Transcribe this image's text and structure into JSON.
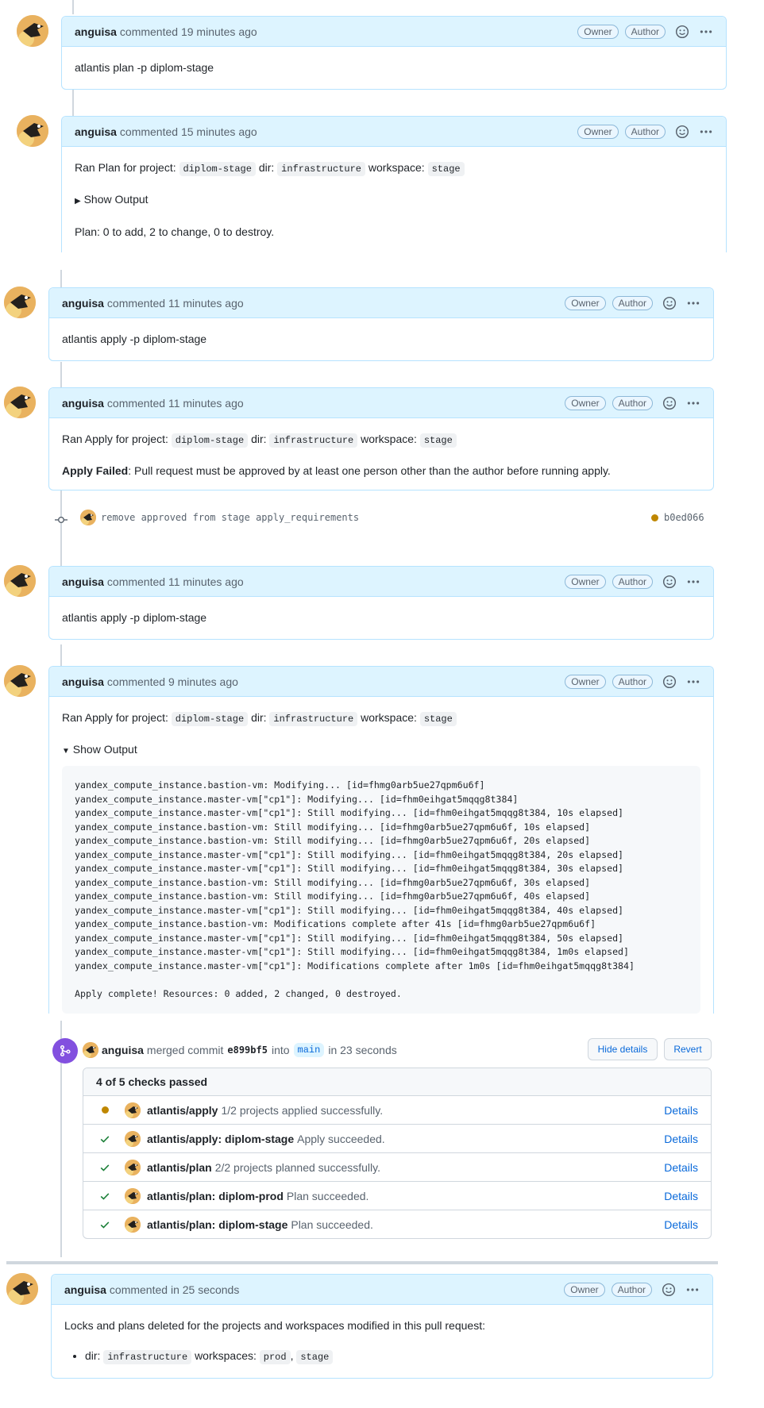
{
  "labels": {
    "owner": "Owner",
    "author": "Author",
    "commented": "commented",
    "show_output": "Show Output"
  },
  "comments": {
    "c1": {
      "author": "anguisa",
      "time": "19 minutes ago",
      "text": "atlantis plan -p diplom-stage"
    },
    "c2": {
      "author": "anguisa",
      "time": "15 minutes ago",
      "p1": "Ran Plan for project:",
      "project": "diplom-stage",
      "dir_label": "dir:",
      "dir": "infrastructure",
      "ws_label": "workspace:",
      "ws": "stage",
      "summary": "Show Output",
      "plan": "Plan: 0 to add, 2 to change, 0 to destroy."
    },
    "c3": {
      "author": "anguisa",
      "time": "11 minutes ago",
      "text": "atlantis apply -p diplom-stage"
    },
    "c4": {
      "author": "anguisa",
      "time": "11 minutes ago",
      "p1": "Ran Apply for project:",
      "project": "diplom-stage",
      "dir_label": "dir:",
      "dir": "infrastructure",
      "ws_label": "workspace:",
      "ws": "stage",
      "failed": "Apply Failed",
      "failed_msg": ": Pull request must be approved by at least one person other than the author before running apply."
    },
    "c5": {
      "author": "anguisa",
      "time": "11 minutes ago",
      "text": "atlantis apply -p diplom-stage"
    },
    "c6": {
      "author": "anguisa",
      "time": "9 minutes ago",
      "p1": "Ran Apply for project:",
      "project": "diplom-stage",
      "dir_label": "dir:",
      "dir": "infrastructure",
      "ws_label": "workspace:",
      "ws": "stage",
      "summary": "Show Output",
      "output": "yandex_compute_instance.bastion-vm: Modifying... [id=fhmg0arb5ue27qpm6u6f]\nyandex_compute_instance.master-vm[\"cp1\"]: Modifying... [id=fhm0eihgat5mqqg8t384]\nyandex_compute_instance.master-vm[\"cp1\"]: Still modifying... [id=fhm0eihgat5mqqg8t384, 10s elapsed]\nyandex_compute_instance.bastion-vm: Still modifying... [id=fhmg0arb5ue27qpm6u6f, 10s elapsed]\nyandex_compute_instance.bastion-vm: Still modifying... [id=fhmg0arb5ue27qpm6u6f, 20s elapsed]\nyandex_compute_instance.master-vm[\"cp1\"]: Still modifying... [id=fhm0eihgat5mqqg8t384, 20s elapsed]\nyandex_compute_instance.master-vm[\"cp1\"]: Still modifying... [id=fhm0eihgat5mqqg8t384, 30s elapsed]\nyandex_compute_instance.bastion-vm: Still modifying... [id=fhmg0arb5ue27qpm6u6f, 30s elapsed]\nyandex_compute_instance.bastion-vm: Still modifying... [id=fhmg0arb5ue27qpm6u6f, 40s elapsed]\nyandex_compute_instance.master-vm[\"cp1\"]: Still modifying... [id=fhm0eihgat5mqqg8t384, 40s elapsed]\nyandex_compute_instance.bastion-vm: Modifications complete after 41s [id=fhmg0arb5ue27qpm6u6f]\nyandex_compute_instance.master-vm[\"cp1\"]: Still modifying... [id=fhm0eihgat5mqqg8t384, 50s elapsed]\nyandex_compute_instance.master-vm[\"cp1\"]: Still modifying... [id=fhm0eihgat5mqqg8t384, 1m0s elapsed]\nyandex_compute_instance.master-vm[\"cp1\"]: Modifications complete after 1m0s [id=fhm0eihgat5mqqg8t384]\n\nApply complete! Resources: 0 added, 2 changed, 0 destroyed."
    },
    "c7": {
      "author": "anguisa",
      "time": "in 25 seconds",
      "text": "Locks and plans deleted for the projects and workspaces modified in this pull request:",
      "li_dir_label": "dir:",
      "li_dir": "infrastructure",
      "li_ws_label": "workspaces:",
      "li_ws1": "prod",
      "li_sep": ",",
      "li_ws2": "stage"
    }
  },
  "commit": {
    "message": "remove approved from stage apply_requirements",
    "sha": "b0ed066"
  },
  "merge": {
    "author": "anguisa",
    "action": "merged commit",
    "sha": "e899bf5",
    "into": "into",
    "branch": "main",
    "time": "in 23 seconds",
    "hide_details": "Hide details",
    "revert": "Revert"
  },
  "checks": {
    "title": "4 of 5 checks passed",
    "details_label": "Details",
    "items": [
      {
        "status": "pending",
        "name": "atlantis/apply",
        "desc": "1/2 projects applied successfully."
      },
      {
        "status": "success",
        "name": "atlantis/apply: diplom-stage",
        "desc": "Apply succeeded."
      },
      {
        "status": "success",
        "name": "atlantis/plan",
        "desc": "2/2 projects planned successfully."
      },
      {
        "status": "success",
        "name": "atlantis/plan: diplom-prod",
        "desc": "Plan succeeded."
      },
      {
        "status": "success",
        "name": "atlantis/plan: diplom-stage",
        "desc": "Plan succeeded."
      }
    ]
  },
  "colors": {
    "header_bg": "#ddf4ff",
    "border": "#b6e3ff",
    "link": "#0969da",
    "merged": "#8250df",
    "success": "#1a7f37",
    "pending": "#bf8700"
  }
}
